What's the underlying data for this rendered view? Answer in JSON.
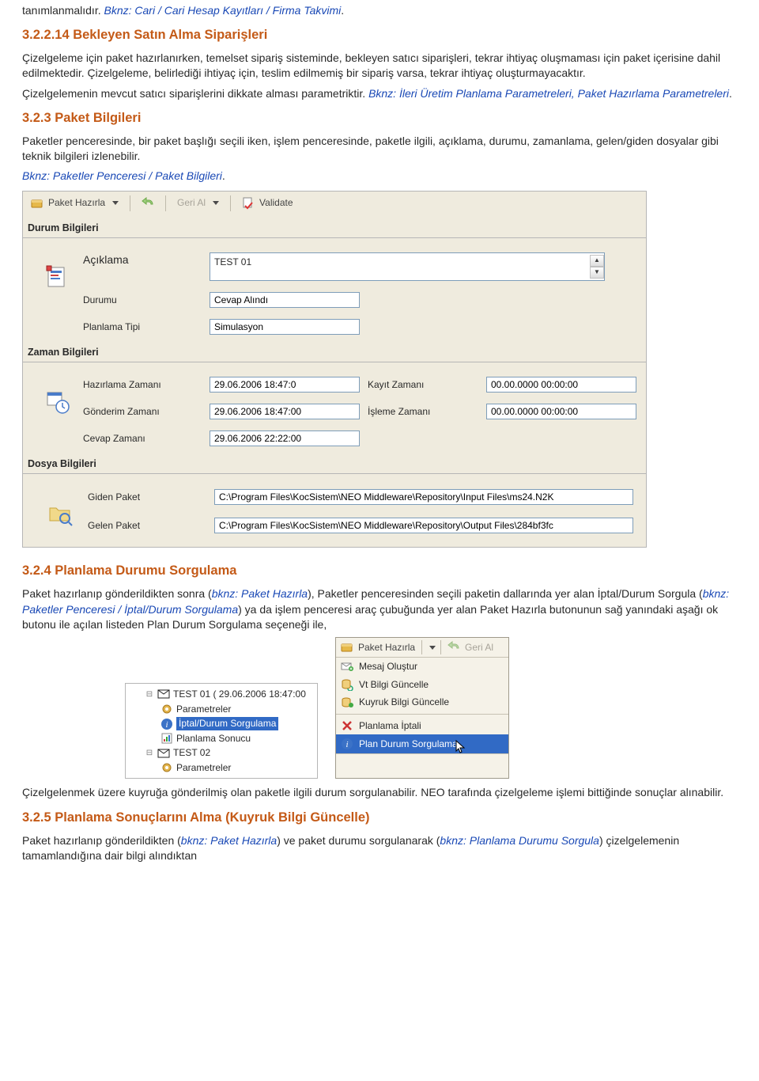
{
  "intro": {
    "line1a": "tanımlanmalıdır.",
    "link1": "Bknz: Cari / Cari Hesap Kayıtları / Firma Takvimi"
  },
  "s3_2_2_14": {
    "title": "3.2.2.14  Bekleyen Satın Alma Siparişleri",
    "para1": "Çizelgeleme için paket hazırlanırken, temelset sipariş sisteminde, bekleyen satıcı siparişleri, tekrar ihtiyaç oluşmaması için paket içerisine dahil edilmektedir. Çizelgeleme, belirlediği ihtiyaç için, teslim edilmemiş bir sipariş varsa, tekrar ihtiyaç oluşturmayacaktır.",
    "para2a": "Çizelgelemenin mevcut satıcı siparişlerini dikkate alması parametriktir.",
    "link2": "Bknz: İleri Üretim Planlama Parametreleri, Paket Hazırlama Parametreleri"
  },
  "s3_2_3": {
    "title": "3.2.3  Paket Bilgileri",
    "para": "Paketler penceresinde, bir paket başlığı seçili iken, işlem penceresinde, paketle ilgili, açıklama, durumu, zamanlama, gelen/giden dosyalar gibi teknik bilgileri izlenebilir.",
    "link": "Bknz: Paketler Penceresi / Paket Bilgileri"
  },
  "toolbar": {
    "paket_hazirla": "Paket Hazırla",
    "geri_al": "Geri Al",
    "validate": "Validate"
  },
  "durum": {
    "header": "Durum Bilgileri",
    "aciklama_label": "Açıklama",
    "aciklama_value": "TEST 01",
    "durum_label": "Durumu",
    "durum_value": "Cevap Alındı",
    "planlama_label": "Planlama Tipi",
    "planlama_value": "Simulasyon"
  },
  "zaman": {
    "header": "Zaman Bilgileri",
    "hazirlama_label": "Hazırlama Zamanı",
    "hazirlama_value": "29.06.2006 18:47:0",
    "gonderim_label": "Gönderim Zamanı",
    "gonderim_value": "29.06.2006 18:47:00",
    "cevap_label": "Cevap Zamanı",
    "cevap_value": "29.06.2006 22:22:00",
    "kayit_label": "Kayıt Zamanı",
    "kayit_value": "00.00.0000 00:00:00",
    "isleme_label": "İşleme Zamanı",
    "isleme_value": "00.00.0000 00:00:00"
  },
  "dosya": {
    "header": "Dosya Bilgileri",
    "giden_label": "Giden Paket",
    "giden_value": "C:\\Program Files\\KocSistem\\NEO Middleware\\Repository\\Input Files\\ms24.N2K",
    "gelen_label": "Gelen Paket",
    "gelen_value": "C:\\Program Files\\KocSistem\\NEO Middleware\\Repository\\Output Files\\284bf3fc"
  },
  "s3_2_4": {
    "title": "3.2.4  Planlama Durumu Sorgulama",
    "para_before_link1": "Paket hazırlanıp gönderildikten sonra (",
    "link1": "bknz: Paket Hazırla",
    "para_mid1": "), Paketler penceresinden seçili paketin dallarında yer alan İptal/Durum Sorgula (",
    "link2": "bknz: Paketler Penceresi / İptal/Durum Sorgulama",
    "para_mid2": ") ya da işlem penceresi araç çubuğunda yer alan Paket Hazırla butonunun sağ yanındaki aşağı ok butonu ile açılan listeden Plan Durum Sorgulama seçeneği ile,"
  },
  "tree": {
    "node1": "TEST 01  ( 29.06.2006 18:47:00",
    "node1a": "Parametreler",
    "node1b": "İptal/Durum Sorgulama",
    "node1c": "Planlama Sonucu",
    "node2": "TEST 02",
    "node2a": "Parametreler"
  },
  "menu": {
    "paket_hazirla": "Paket Hazırla",
    "geri_al": "Geri Al",
    "mesaj": "Mesaj Oluştur",
    "vt": "Vt Bilgi Güncelle",
    "kuyruk": "Kuyruk Bilgi Güncelle",
    "iptal": "Planlama İptali",
    "plan_sorg": "Plan Durum Sorgulama"
  },
  "after_tree": {
    "para": "Çizelgelenmek üzere kuyruğa gönderilmiş olan paketle ilgili durum sorgulanabilir. NEO tarafında çizelgeleme işlemi bittiğinde sonuçlar alınabilir."
  },
  "s3_2_5": {
    "title": "3.2.5  Planlama Sonuçlarını Alma (Kuyruk Bilgi Güncelle)",
    "para_before_link1": "Paket hazırlanıp gönderildikten (",
    "link1": "bknz: Paket Hazırla",
    "para_mid1": ") ve paket durumu sorgulanarak (",
    "link2": "bknz: Planlama Durumu Sorgula",
    "para_mid2": ") çizelgelemenin tamamlandığına dair bilgi alındıktan"
  }
}
